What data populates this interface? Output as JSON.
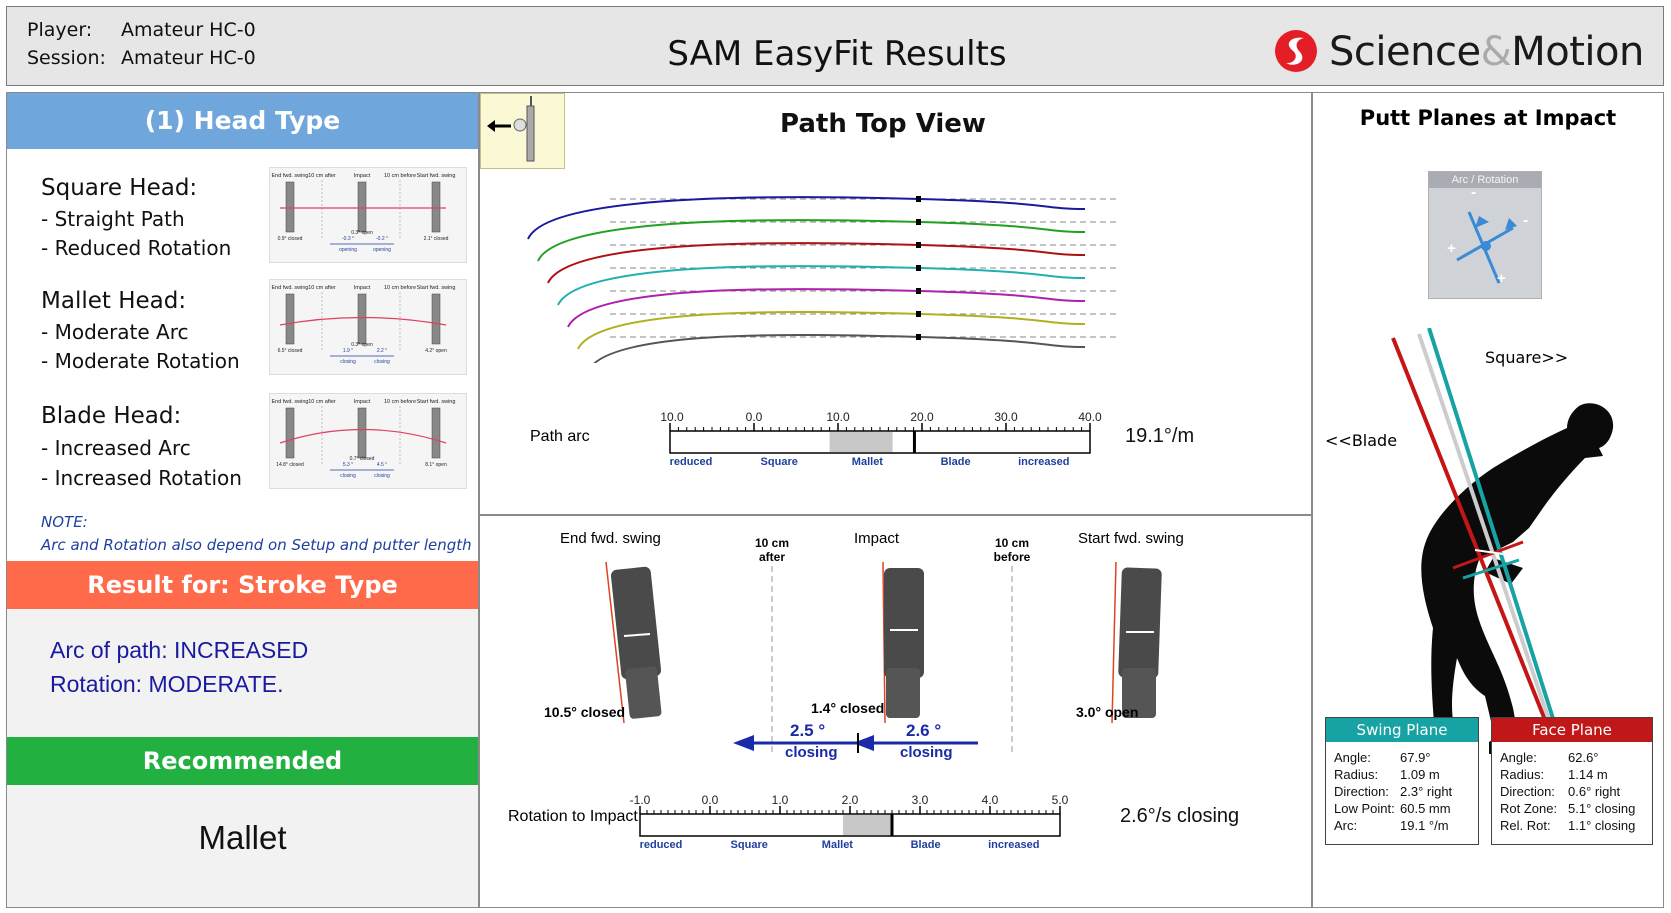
{
  "header": {
    "player_label": "Player:",
    "player_value": "Amateur HC-0",
    "session_label": "Session:",
    "session_value": "Amateur HC-0",
    "title": "SAM EasyFit Results",
    "logo_part1": "Science",
    "logo_amp": "&",
    "logo_part2": "Motion"
  },
  "left": {
    "head_type_title": "(1) Head Type",
    "square": {
      "title": "Square Head:",
      "items": [
        "- Straight Path",
        "- Reduced Rotation"
      ]
    },
    "mallet": {
      "title": "Mallet Head:",
      "items": [
        "- Moderate Arc",
        "- Moderate Rotation"
      ]
    },
    "blade": {
      "title": "Blade Head:",
      "items": [
        "- Increased Arc",
        "- Increased Rotation"
      ]
    },
    "note_title": "NOTE:",
    "note_text": "Arc and Rotation also depend on Setup and putter length",
    "result_title": "Result for: Stroke Type",
    "result_arc": "Arc of path: INCREASED",
    "result_rotation": "Rotation: MODERATE.",
    "recommended_title": "Recommended",
    "recommended_value": "Mallet",
    "thumbs": [
      {
        "c1": "End fwd. swing",
        "c2": "10 cm after",
        "c3": "Impact",
        "c4": "10 cm before",
        "c5": "Start fwd. swing",
        "v1": "0.9° closed",
        "v2": "-0.3 °",
        "v3": "-0.2 °",
        "v4": "0.3° open",
        "v5": "2.1° closed",
        "s1": "opening",
        "s2": "opening"
      },
      {
        "c1": "End fwd. swing",
        "c2": "10 cm after",
        "c3": "Impact",
        "c4": "10 cm before",
        "c5": "Start fwd. swing",
        "v1": "6.5° closed",
        "v2": "1.9 °",
        "v3": "2.2 °",
        "v4": "0.3° open",
        "v5": "4.2° open",
        "s1": "closing",
        "s2": "closing"
      },
      {
        "c1": "End fwd. swing",
        "c2": "10 cm after",
        "c3": "Impact",
        "c4": "10 cm before",
        "c5": "Start fwd. swing",
        "v1": "14.8° closed",
        "v2": "5.3 °",
        "v3": "4.5 °",
        "v4": "0.7° closed",
        "v5": "8.1° open",
        "s1": "closing",
        "s2": "closing"
      }
    ]
  },
  "path_view": {
    "title": "Path Top View",
    "arc_label": "Path arc",
    "arc_value": "19.1°/m",
    "scale_ticks": [
      "-10.0",
      "0.0",
      "10.0",
      "20.0",
      "30.0",
      "40.0"
    ],
    "scale_zones": [
      "reduced",
      "Square",
      "Mallet",
      "Blade",
      "increased"
    ],
    "scale_min": -10,
    "scale_max": 40,
    "highlight_range": [
      9,
      16.5
    ],
    "marker_value": 19.1,
    "path_colors": [
      "#1a1a9a",
      "#22a022",
      "#b01010",
      "#20b0b0",
      "#b020b0",
      "#b0b020",
      "#555555"
    ]
  },
  "rotation_view": {
    "col_end": "End fwd. swing",
    "col_after": "10 cm after",
    "col_impact": "Impact",
    "col_before": "10 cm before",
    "col_start": "Start fwd. swing",
    "val_end": "10.5° closed",
    "val_impact": "1.4° closed",
    "val_start": "3.0° open",
    "arrow_left_val": "2.5 °",
    "arrow_left_sub": "closing",
    "arrow_right_val": "2.6 °",
    "arrow_right_sub": "closing",
    "label": "Rotation to Impact",
    "value": "2.6°/s closing",
    "scale_ticks": [
      "-1.0",
      "0.0",
      "1.0",
      "2.0",
      "3.0",
      "4.0",
      "5.0"
    ],
    "scale_zones": [
      "reduced",
      "Square",
      "Mallet",
      "Blade",
      "increased"
    ],
    "scale_min": -1,
    "scale_max": 5,
    "highlight_range": [
      1.9,
      2.6
    ],
    "marker_value": 2.6
  },
  "planes": {
    "title": "Putt Planes at Impact",
    "inset_label": "Arc / Rotation",
    "inset_minus": "-",
    "inset_plus": "+",
    "square_label": "Square>>",
    "blade_label": "<<Blade",
    "swing_plane": {
      "title": "Swing Plane",
      "color": "#17a3a3",
      "rows": [
        {
          "k": "Angle:",
          "v": "67.9°"
        },
        {
          "k": "Radius:",
          "v": "1.09 m"
        },
        {
          "k": "Direction:",
          "v": "2.3° right"
        },
        {
          "k": "Low Point:",
          "v": "60.5 mm"
        },
        {
          "k": "Arc:",
          "v": "19.1 °/m"
        }
      ]
    },
    "face_plane": {
      "title": "Face Plane",
      "color": "#c01818",
      "rows": [
        {
          "k": "Angle:",
          "v": "62.6°"
        },
        {
          "k": "Radius:",
          "v": "1.14 m"
        },
        {
          "k": "Direction:",
          "v": "0.6° right"
        },
        {
          "k": "Rot Zone:",
          "v": "5.1° closing"
        },
        {
          "k": "Rel. Rot:",
          "v": "1.1° closing"
        }
      ]
    }
  },
  "colors": {
    "head_type_band": "#6fa6dc",
    "result_band": "#ff6a4a",
    "recommended_band": "#22b040"
  }
}
